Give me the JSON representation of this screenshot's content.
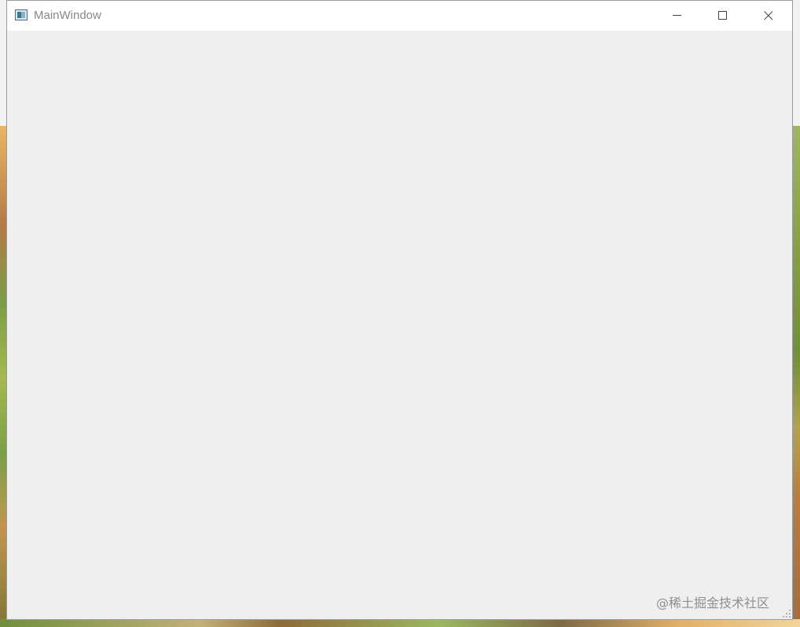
{
  "window": {
    "title": "MainWindow",
    "icon": "qt-window-icon"
  },
  "titlebar": {
    "buttons": {
      "minimize": {
        "icon": "minimize-icon"
      },
      "maximize": {
        "icon": "maximize-icon"
      },
      "close": {
        "icon": "close-icon"
      }
    }
  },
  "client": {
    "background": "#efefef"
  },
  "watermark": {
    "text": "@稀土掘金技术社区"
  },
  "colors": {
    "titlebar": "#ffffff",
    "titleText": "#888888",
    "windowBorder": "#9b9b9b"
  }
}
